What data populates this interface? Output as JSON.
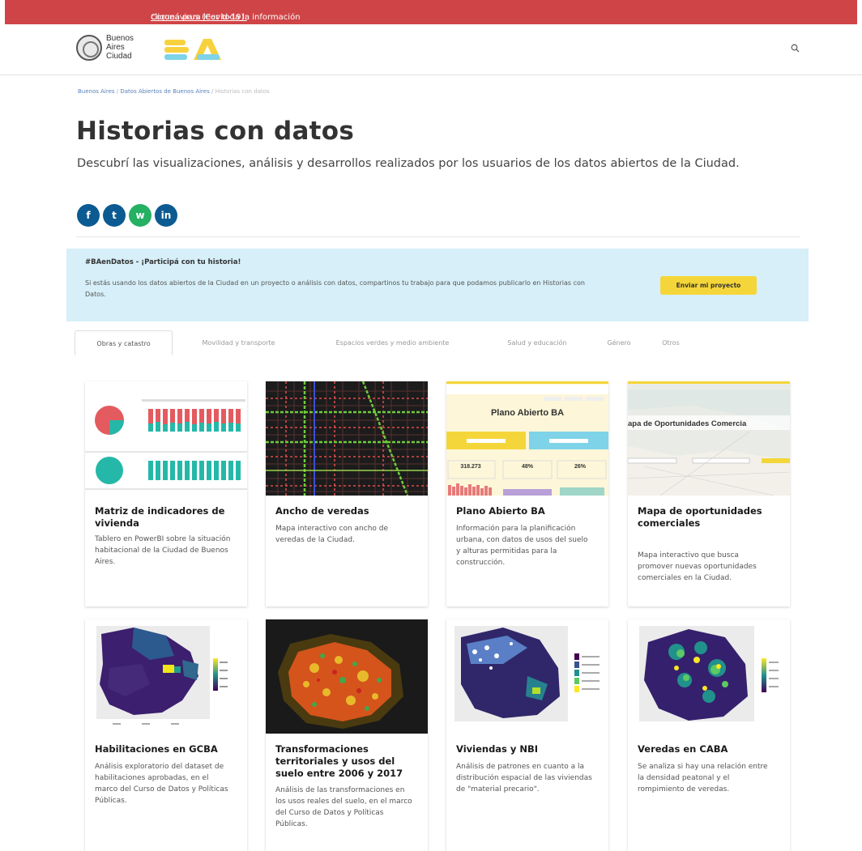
{
  "alert": {
    "link": "Coronavirus (Covid-19):",
    "text": " cliqueá para leer toda la información"
  },
  "header": {
    "logo_line1": "Buenos",
    "logo_line2": "Aires",
    "logo_line3": "Ciudad",
    "brand": "BA",
    "search_icon": "search-icon"
  },
  "breadcrumb": [
    {
      "label": "Buenos Aires"
    },
    {
      "label": "Datos Abiertos de Buenos Aires"
    },
    {
      "label": "Historias con datos"
    }
  ],
  "breadcrumb_separator": " / ",
  "page": {
    "title": "Historias con datos",
    "subtitle": "Descubrí las visualizaciones, análisis y desarrollos realizados por los usuarios de los datos abiertos de la Ciudad."
  },
  "social": [
    {
      "name": "facebook",
      "icon": "facebook-icon",
      "glyph": "f"
    },
    {
      "name": "twitter",
      "icon": "twitter-icon",
      "glyph": "t"
    },
    {
      "name": "whatsapp",
      "icon": "whatsapp-icon",
      "glyph": "w"
    },
    {
      "name": "linkedin",
      "icon": "linkedin-icon",
      "glyph": "in"
    }
  ],
  "banner": {
    "title": "#BAenDatos - ¡Participá con tu historia!",
    "text": "Si estás usando los datos abiertos de la Ciudad en un proyecto o análisis con datos, compartinos tu trabajo para que podamos publicarlo en Historias con Datos.",
    "button": "Enviar mi proyecto"
  },
  "tabs": [
    {
      "label": "Obras y catastro",
      "active": true
    },
    {
      "label": "Movilidad y transporte",
      "active": false
    },
    {
      "label": "Espacios verdes y medio ambiente",
      "active": false
    },
    {
      "label": "Salud y educación",
      "active": false
    },
    {
      "label": "Género",
      "active": false
    },
    {
      "label": "Otros",
      "active": false
    }
  ],
  "cards": [
    {
      "title": "Matriz de indicadores de vivienda",
      "desc": "Tablero en PowerBI sobre la situación habitacional de la Ciudad de Buenos Aires."
    },
    {
      "title": "Ancho de veredas",
      "desc": "Mapa interactivo con ancho de veredas de la Ciudad."
    },
    {
      "title": "Plano Abierto BA",
      "desc": "Información para la planificación urbana, con datos de usos del suelo y alturas permitidas para la construcción.",
      "thumb_title": "Plano Abierto BA",
      "thumb_stats": [
        "318.273",
        "48%",
        "26%"
      ]
    },
    {
      "title": "Mapa de oportunidades comerciales",
      "desc": "Mapa interactivo que busca promover nuevas oportunidades comerciales en la Ciudad.",
      "thumb_title": "apa de Oportunidades Comercia"
    },
    {
      "title": "Habilitaciones en GCBA",
      "desc": "Análisis exploratorio del dataset de habilitaciones aprobadas, en el marco del Curso de Datos y Políticas Públicas."
    },
    {
      "title": "Transformaciones territoriales y usos del suelo entre 2006 y 2017",
      "desc": "Análisis de las transformaciones en los usos reales del suelo, en el marco del Curso de Datos y Políticas Públicas."
    },
    {
      "title": "Viviendas y NBI",
      "desc": "Análisis de patrones en cuanto a la distribución espacial de las viviendas de \"material precario\"."
    },
    {
      "title": "Veredas en CABA",
      "desc": "Se analiza si hay una relación entre la densidad peatonal y el rompimiento de veredas."
    }
  ],
  "colors": {
    "alert": "#cf4446",
    "banner": "#d6eff8",
    "accent_button": "#f5d63a",
    "social": "#0c5a92",
    "whatsapp": "#25b064",
    "link": "#5a82b8"
  }
}
